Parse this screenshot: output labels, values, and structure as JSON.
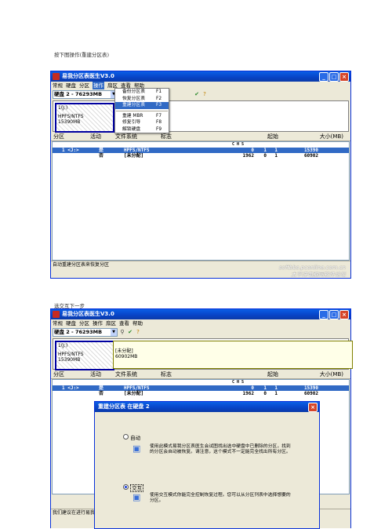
{
  "caption1": "按下图操作(重建分区表)",
  "caption2": "选交互下一步",
  "app": {
    "title": "易我分区表医生V3.0",
    "menus": [
      "常规",
      "硬盘",
      "分区",
      "操作",
      "扇区",
      "查看",
      "帮助"
    ],
    "disk_select": "硬盘 2 - 76293MB"
  },
  "ops_menu": [
    {
      "label": "备份分区表",
      "key": "F1"
    },
    {
      "label": "恢复分区表",
      "key": "F2"
    },
    {
      "label": "重建分区表",
      "key": "F3"
    },
    {
      "label": "重建 MBR",
      "key": "F7"
    },
    {
      "label": "修复引导",
      "key": "F8"
    },
    {
      "label": "解锁硬盘",
      "key": "F9"
    }
  ],
  "partition": {
    "label": "1(J:)",
    "fs": "HPFS/NTFS",
    "size": "15390MB"
  },
  "free": {
    "label": "[未分配]",
    "size": "60902MB"
  },
  "columns": {
    "part": "分区",
    "active": "活动",
    "fs": "文件系统",
    "flag": "标志",
    "start": "起始",
    "size": "大小(MB)"
  },
  "chs": "C    H    S",
  "rows": [
    {
      "part": "1 <J:>",
      "active": "是",
      "fs": "HPFS/NTFS",
      "c": "0",
      "h": "1",
      "s": "1",
      "size": "15390"
    },
    {
      "part": "",
      "active": "否",
      "fs": "[未分配]",
      "c": "1962",
      "h": "0",
      "s": "1",
      "size": "60902"
    }
  ],
  "status1": "自动重建分区表来恢复分区",
  "status2": "我们建议在进行易我",
  "watermark1": "softbbs.pconline.com.cn",
  "watermark2": "太平洋电脑网软件论坛",
  "dialog": {
    "title": "重建分区表 在硬盘 2",
    "auto_label": "自动",
    "auto_desc": "使用此模式易我分区表医生会试图找出选中硬盘中已删除的分区，找到的分区会自动被恢复。请注意，这个模式不一定能完全找出所有分区。",
    "interactive_label": "交互",
    "interactive_desc": "使用交互模式你能完全控制恢复过程。您可以从分区列表中选择想要的分区。"
  }
}
